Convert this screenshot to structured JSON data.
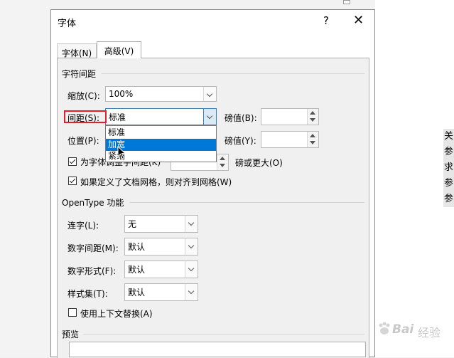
{
  "background": {
    "side_text": [
      "关",
      "参",
      "求",
      "参",
      "参"
    ]
  },
  "dialog": {
    "title": "字体",
    "help_label": "?",
    "close_label": "✕",
    "tabs": [
      {
        "label": "字体(N)",
        "active": false
      },
      {
        "label": "高级(V)",
        "active": true
      }
    ]
  },
  "char_spacing": {
    "group_label": "字符间距",
    "scale": {
      "label": "缩放(C):",
      "value": "100%"
    },
    "spacing": {
      "label": "间距(S):",
      "value": "标准",
      "options": [
        "标准",
        "加宽",
        "紧缩"
      ],
      "highlighted": "加宽"
    },
    "spacing_pts": {
      "label": "磅值(B):",
      "value": ""
    },
    "position": {
      "label": "位置(P):"
    },
    "position_pts": {
      "label": "磅值(Y):",
      "value": ""
    },
    "kerning": {
      "label": "为字体调整字间距(K)",
      "suffix": "磅或更大(O)",
      "checked": true
    },
    "grid_snap": {
      "label": "如果定义了文档网格，则对齐到网格(W)",
      "checked": true
    }
  },
  "opentype": {
    "group_label": "OpenType 功能",
    "ligatures": {
      "label": "连字(L):",
      "value": "无"
    },
    "number_spacing": {
      "label": "数字间距(M):",
      "value": "默认"
    },
    "number_forms": {
      "label": "数字形式(F):",
      "value": "默认"
    },
    "stylistic_sets": {
      "label": "样式集(T):",
      "value": "默认"
    },
    "contextual_alternates": {
      "label": "使用上下文替换(A)",
      "checked": false
    }
  },
  "preview": {
    "group_label": "预览"
  },
  "watermark": {
    "text": "Bai",
    "text2": "经验"
  },
  "colors": {
    "accent": "#0078d7",
    "highlight_box": "#e0202a"
  }
}
